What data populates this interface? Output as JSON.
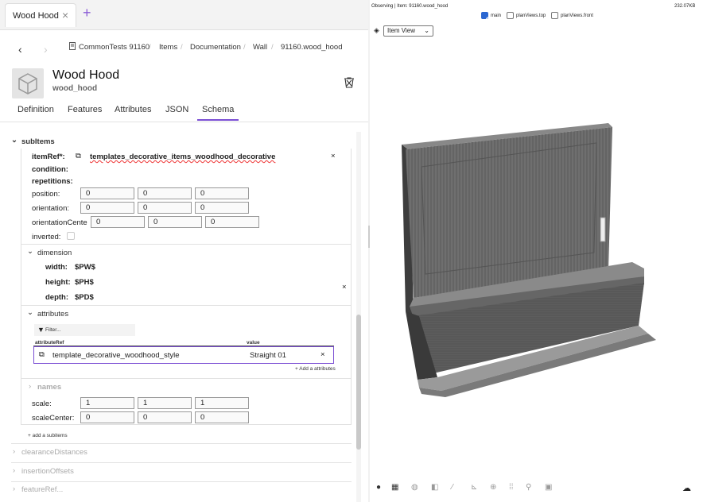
{
  "tab": {
    "title": "Wood Hood"
  },
  "breadcrumb": {
    "items": [
      "CommonTests 91160",
      "Items",
      "Documentation",
      "Wall",
      "91160.wood_hood"
    ]
  },
  "header": {
    "title": "Wood Hood",
    "subtitle": "wood_hood"
  },
  "tabs": [
    "Definition",
    "Features",
    "Attributes",
    "JSON",
    "Schema"
  ],
  "active_tab": "Schema",
  "schema": {
    "subitems_label": "subItems",
    "itemref_label": "itemRef*:",
    "itemref_value": "templates_decorative_items_woodhood_decorative",
    "condition_label": "condition:",
    "repetitions_label": "repetitions:",
    "position_label": "position:",
    "position": [
      "0",
      "0",
      "0"
    ],
    "orientation_label": "orientation:",
    "orientation": [
      "0",
      "0",
      "0"
    ],
    "orientation_center_label": "orientationCente",
    "orientation_center": [
      "0",
      "0",
      "0"
    ],
    "inverted_label": "inverted:",
    "dimension_label": "dimension",
    "width_label": "width:",
    "width_value": "$PW$",
    "height_label": "height:",
    "height_value": "$PH$",
    "depth_label": "depth:",
    "depth_value": "$PD$",
    "attributes_label": "attributes",
    "filter_placeholder": "Filter...",
    "col_attributeref": "attributeRef",
    "col_value": "value",
    "attr_row_ref": "template_decorative_woodhood_style",
    "attr_row_value": "Straight 01",
    "add_attributes": "+ Add a attributes",
    "names_label": "names",
    "scale_label": "scale:",
    "scale": [
      "1",
      "1",
      "1"
    ],
    "scale_center_label": "scaleCenter:",
    "scale_center": [
      "0",
      "0",
      "0"
    ],
    "add_subitems": "+ add a subitems",
    "clearance_label": "clearanceDistances",
    "insertion_label": "insertionOffsets",
    "cut_label": "featureRef..."
  },
  "viewer": {
    "status": "Observing | Item: 91160.wood_hood",
    "size": "232.07KB",
    "checkboxes": [
      {
        "label": "main",
        "checked": true
      },
      {
        "label": "planViews.top",
        "checked": false
      },
      {
        "label": "planViews.front",
        "checked": false
      }
    ],
    "view_select": "Item View"
  },
  "colors": {
    "accent": "#7b4fd4",
    "checkbox": "#2a66d1"
  }
}
